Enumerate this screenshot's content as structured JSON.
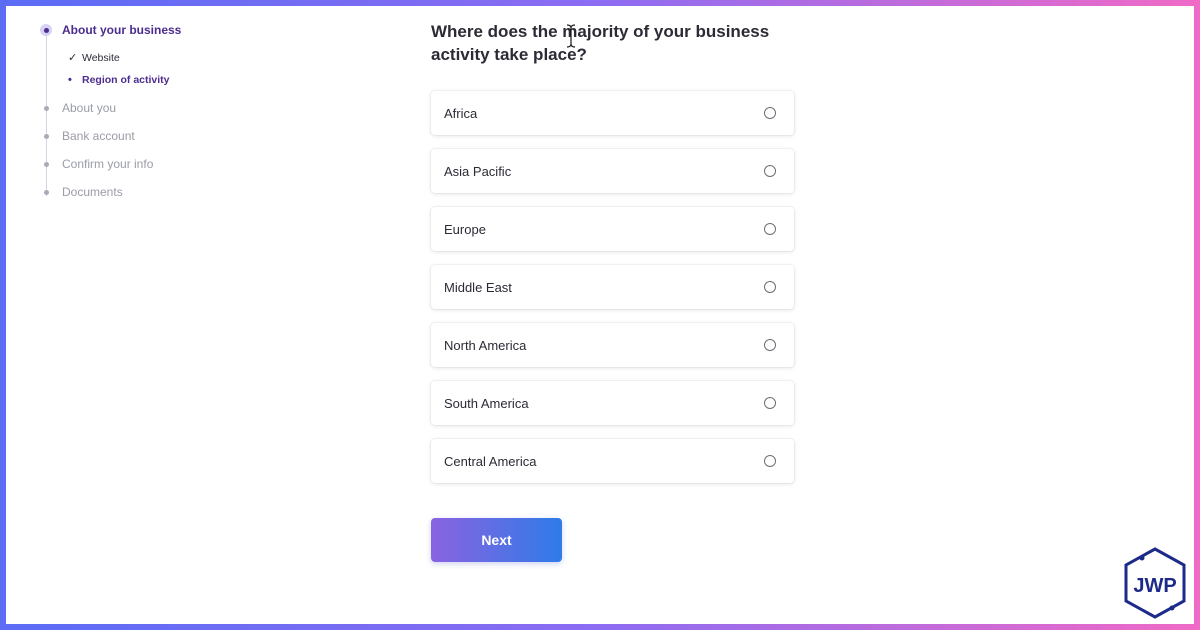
{
  "sidebar": {
    "steps": [
      {
        "label": "About your business",
        "state": "active"
      },
      {
        "label": "About you",
        "state": "pending"
      },
      {
        "label": "Bank account",
        "state": "pending"
      },
      {
        "label": "Confirm your info",
        "state": "pending"
      },
      {
        "label": "Documents",
        "state": "pending"
      }
    ],
    "substeps": [
      {
        "label": "Website",
        "state": "done"
      },
      {
        "label": "Region of activity",
        "state": "current"
      }
    ]
  },
  "main": {
    "question": "Where does the majority of your business activity take place?",
    "options": [
      {
        "label": "Africa",
        "selected": false
      },
      {
        "label": "Asia Pacific",
        "selected": false
      },
      {
        "label": "Europe",
        "selected": false
      },
      {
        "label": "Middle East",
        "selected": false
      },
      {
        "label": "North America",
        "selected": false
      },
      {
        "label": "South America",
        "selected": false
      },
      {
        "label": "Central America",
        "selected": false
      }
    ],
    "next_label": "Next"
  },
  "watermark": {
    "text": "JWP"
  },
  "colors": {
    "accent": "#4c2c8f",
    "button_start": "#8a63e0",
    "button_end": "#2f7be8",
    "frame_left": "#5b6cf5",
    "frame_right": "#f06ac6"
  }
}
